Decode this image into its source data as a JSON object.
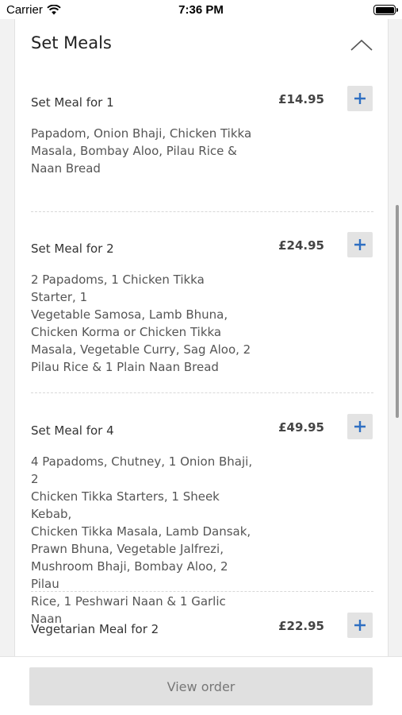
{
  "status_bar": {
    "carrier": "Carrier",
    "time": "7:36 PM"
  },
  "section": {
    "title": "Set Meals",
    "collapse_icon": "chevron-up-icon"
  },
  "items": [
    {
      "name": "Set Meal for 1",
      "price": "£14.95",
      "description": [
        "Papadom, Onion Bhaji, Chicken Tikka",
        "Masala, Bombay Aloo, Pilau Rice &",
        "Naan Bread"
      ]
    },
    {
      "name": "Set Meal for 2",
      "price": "£24.95",
      "description": [
        "2 Papadoms, 1 Chicken Tikka Starter, 1",
        "Vegetable Samosa, Lamb Bhuna,",
        "Chicken Korma or Chicken Tikka",
        "Masala, Vegetable Curry, Sag Aloo, 2",
        "Pilau Rice & 1 Plain Naan Bread"
      ]
    },
    {
      "name": "Set Meal for 4",
      "price": "£49.95",
      "description": [
        "4 Papadoms, Chutney, 1 Onion Bhaji, 2",
        "Chicken Tikka Starters, 1 Sheek Kebab,",
        "Chicken Tikka Masala, Lamb Dansak,",
        "Prawn Bhuna, Vegetable Jalfrezi,",
        "Mushroom Bhaji, Bombay Aloo, 2 Pilau",
        "Rice, 1 Peshwari Naan & 1 Garlic Naan"
      ]
    },
    {
      "name": "Vegetarian Meal for 2",
      "price": "£22.95",
      "description": []
    }
  ],
  "add_icon": "plus-icon",
  "accent_color": "#2f6fc2",
  "footer": {
    "view_order_label": "View order"
  }
}
